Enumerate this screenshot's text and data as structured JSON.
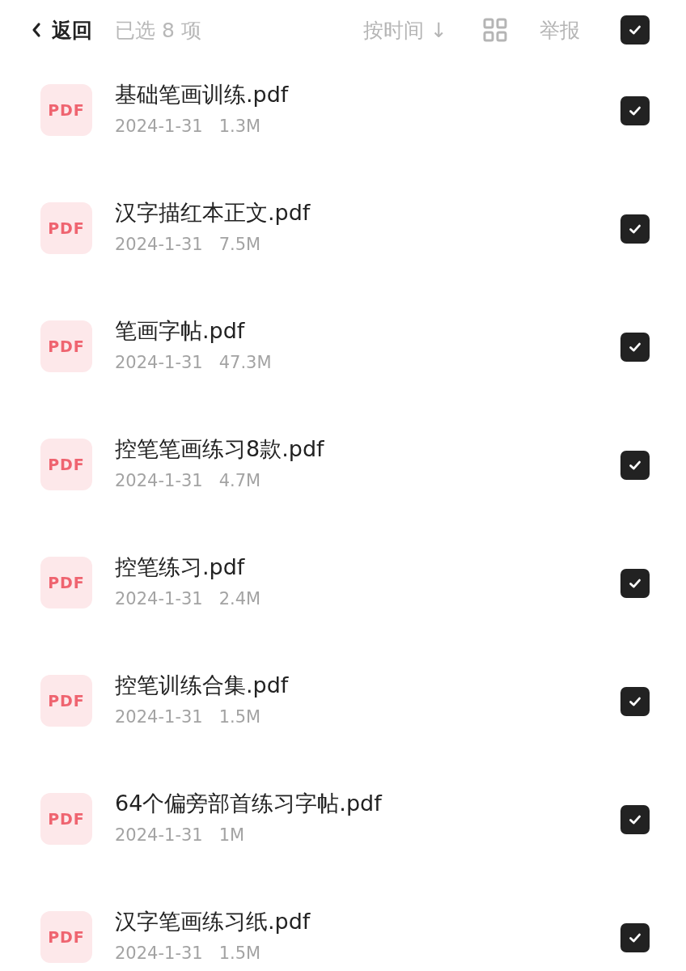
{
  "header": {
    "back_label": "返回",
    "selection_count": "已选 8 项",
    "sort_label": "按时间",
    "sort_arrow": "↓",
    "report_label": "举报",
    "all_checked": true
  },
  "files": [
    {
      "icon_label": "PDF",
      "name": "基础笔画训练.pdf",
      "date": "2024-1-31",
      "size": "1.3M",
      "checked": true
    },
    {
      "icon_label": "PDF",
      "name": "汉字描红本正文.pdf",
      "date": "2024-1-31",
      "size": "7.5M",
      "checked": true
    },
    {
      "icon_label": "PDF",
      "name": "笔画字帖.pdf",
      "date": "2024-1-31",
      "size": "47.3M",
      "checked": true
    },
    {
      "icon_label": "PDF",
      "name": "控笔笔画练习8款.pdf",
      "date": "2024-1-31",
      "size": "4.7M",
      "checked": true
    },
    {
      "icon_label": "PDF",
      "name": "控笔练习.pdf",
      "date": "2024-1-31",
      "size": "2.4M",
      "checked": true
    },
    {
      "icon_label": "PDF",
      "name": "控笔训练合集.pdf",
      "date": "2024-1-31",
      "size": "1.5M",
      "checked": true
    },
    {
      "icon_label": "PDF",
      "name": "64个偏旁部首练习字帖.pdf",
      "date": "2024-1-31",
      "size": "1M",
      "checked": true
    },
    {
      "icon_label": "PDF",
      "name": "汉字笔画练习纸.pdf",
      "date": "2024-1-31",
      "size": "1.5M",
      "checked": true
    }
  ]
}
